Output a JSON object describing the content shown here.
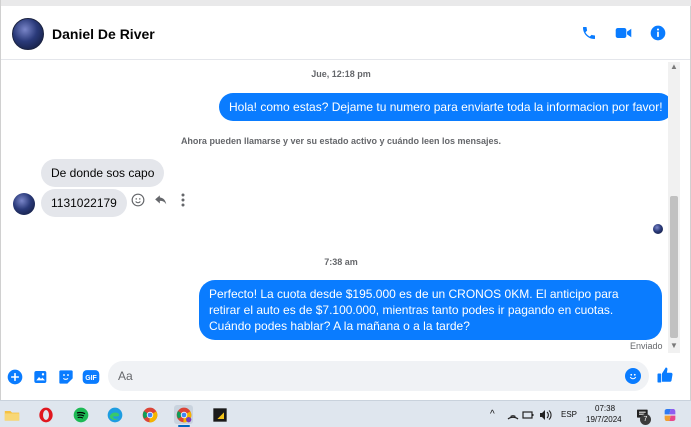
{
  "header": {
    "contact_name": "Daniel De River",
    "icons": [
      "phone-icon",
      "video-icon",
      "info-icon"
    ],
    "accent": "#0a7cff"
  },
  "conversation": {
    "timestamp_1": "Jue, 12:18 pm",
    "outgoing_1": "Hola! como estas? Dejame tu numero para enviarte toda la informacion por favor!",
    "system_notice": "Ahora pueden llamarse y ver su estado activo y cuándo leen los mensajes.",
    "incoming_1": "De donde sos capo",
    "incoming_2": "1131022179",
    "timestamp_2": "7:38 am",
    "outgoing_2": "Perfecto! La cuota desde $195.000 es de un CRONOS 0KM. El anticipo para retirar el auto es de $7.100.000, mientras tanto podes ir pagando en cuotas. Cuándo podes hablar? A la mañana o a la tarde?",
    "status": "Enviado",
    "message_actions": [
      "emoji-react-icon",
      "reply-icon",
      "more-icon"
    ]
  },
  "composer": {
    "placeholder": "Aa",
    "icons": [
      "plus-icon",
      "image-icon",
      "sticker-icon",
      "gif-icon",
      "emoji-icon",
      "like-icon"
    ],
    "gif_label": "GIF"
  },
  "taskbar": {
    "apps": [
      "file-explorer-icon",
      "opera-icon",
      "spotify-icon",
      "edge-icon",
      "chrome-icon",
      "chrome-profile-icon",
      "sticky-app-icon"
    ],
    "language": "ESP",
    "time": "07:38",
    "date": "19/7/2024",
    "notification_count": "7"
  }
}
